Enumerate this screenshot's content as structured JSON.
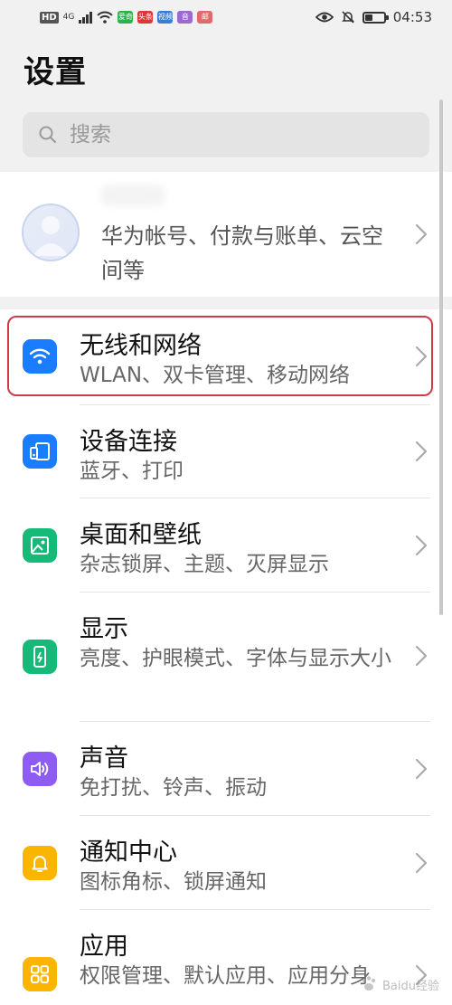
{
  "status_bar": {
    "hd": "HD",
    "network": "4G",
    "apps": [
      {
        "name": "iqiyi-app-icon",
        "text": "爱奇",
        "color": "#2bb24c"
      },
      {
        "name": "news-app-icon",
        "text": "头条",
        "color": "#e0353b"
      },
      {
        "name": "video-app-icon",
        "text": "视频",
        "color": "#3a7bd5"
      },
      {
        "name": "music-app-icon",
        "text": "音",
        "color": "#9b6ad0"
      },
      {
        "name": "mail-app-icon",
        "text": "邮",
        "color": "#e26a6a"
      }
    ],
    "time": "04:53"
  },
  "page_title": "设置",
  "search": {
    "placeholder": "搜索"
  },
  "account": {
    "text": "华为帐号、付款与账单、云空间等"
  },
  "items": [
    {
      "title": "无线和网络",
      "subtitle": "WLAN、双卡管理、移动网络",
      "icon": "wifi-icon",
      "color": "#1a7dff"
    },
    {
      "title": "设备连接",
      "subtitle": "蓝牙、打印",
      "icon": "device-connection-icon",
      "color": "#1a7dff"
    },
    {
      "title": "桌面和壁纸",
      "subtitle": "杂志锁屏、主题、灭屏显示",
      "icon": "wallpaper-icon",
      "color": "#17b978"
    },
    {
      "title": "显示",
      "subtitle": "亮度、护眼模式、字体与显示大小",
      "icon": "display-icon",
      "color": "#17b978"
    },
    {
      "title": "声音",
      "subtitle": "免打扰、铃声、振动",
      "icon": "sound-icon",
      "color": "#8e5cf2"
    },
    {
      "title": "通知中心",
      "subtitle": "图标角标、锁屏通知",
      "icon": "notification-icon",
      "color": "#f9b500"
    },
    {
      "title": "应用",
      "subtitle": "权限管理、默认应用、应用分身",
      "icon": "apps-icon",
      "color": "#f9b500"
    }
  ],
  "watermark": "Baidu经验"
}
